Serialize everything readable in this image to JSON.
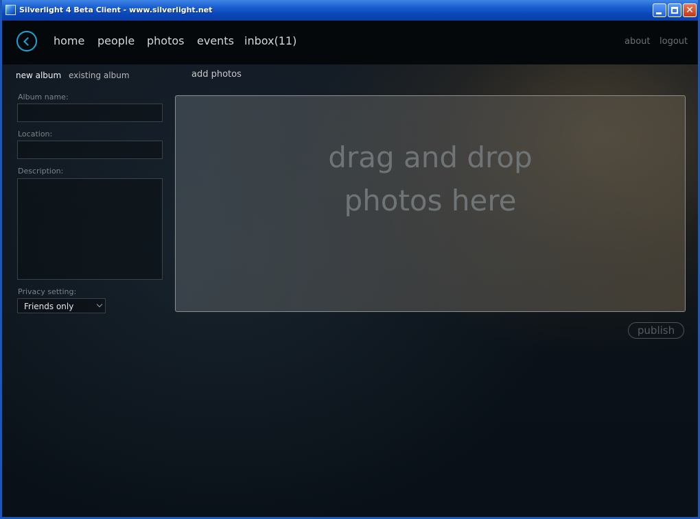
{
  "window": {
    "title": "Silverlight 4 Beta Client - www.silverlight.net"
  },
  "nav": {
    "items": [
      "home",
      "people",
      "photos",
      "events",
      "inbox(11)"
    ],
    "right_links": [
      "about",
      "logout"
    ]
  },
  "tabs": {
    "new_album": "new album",
    "existing_album": "existing album"
  },
  "section_title": "add photos",
  "form": {
    "album_name_label": "Album name:",
    "album_name_value": "",
    "location_label": "Location:",
    "location_value": "",
    "description_label": "Description:",
    "description_value": "",
    "privacy_label": "Privacy setting:",
    "privacy_value": "Friends only"
  },
  "drop_zone": {
    "line1": "drag and drop",
    "line2": "photos here"
  },
  "publish_label": "publish",
  "colors": {
    "accent": "#1aa6d8",
    "titlebar": "#1a5fd0",
    "nav_bg": "#05080b",
    "app_bg": "#0b1219"
  }
}
